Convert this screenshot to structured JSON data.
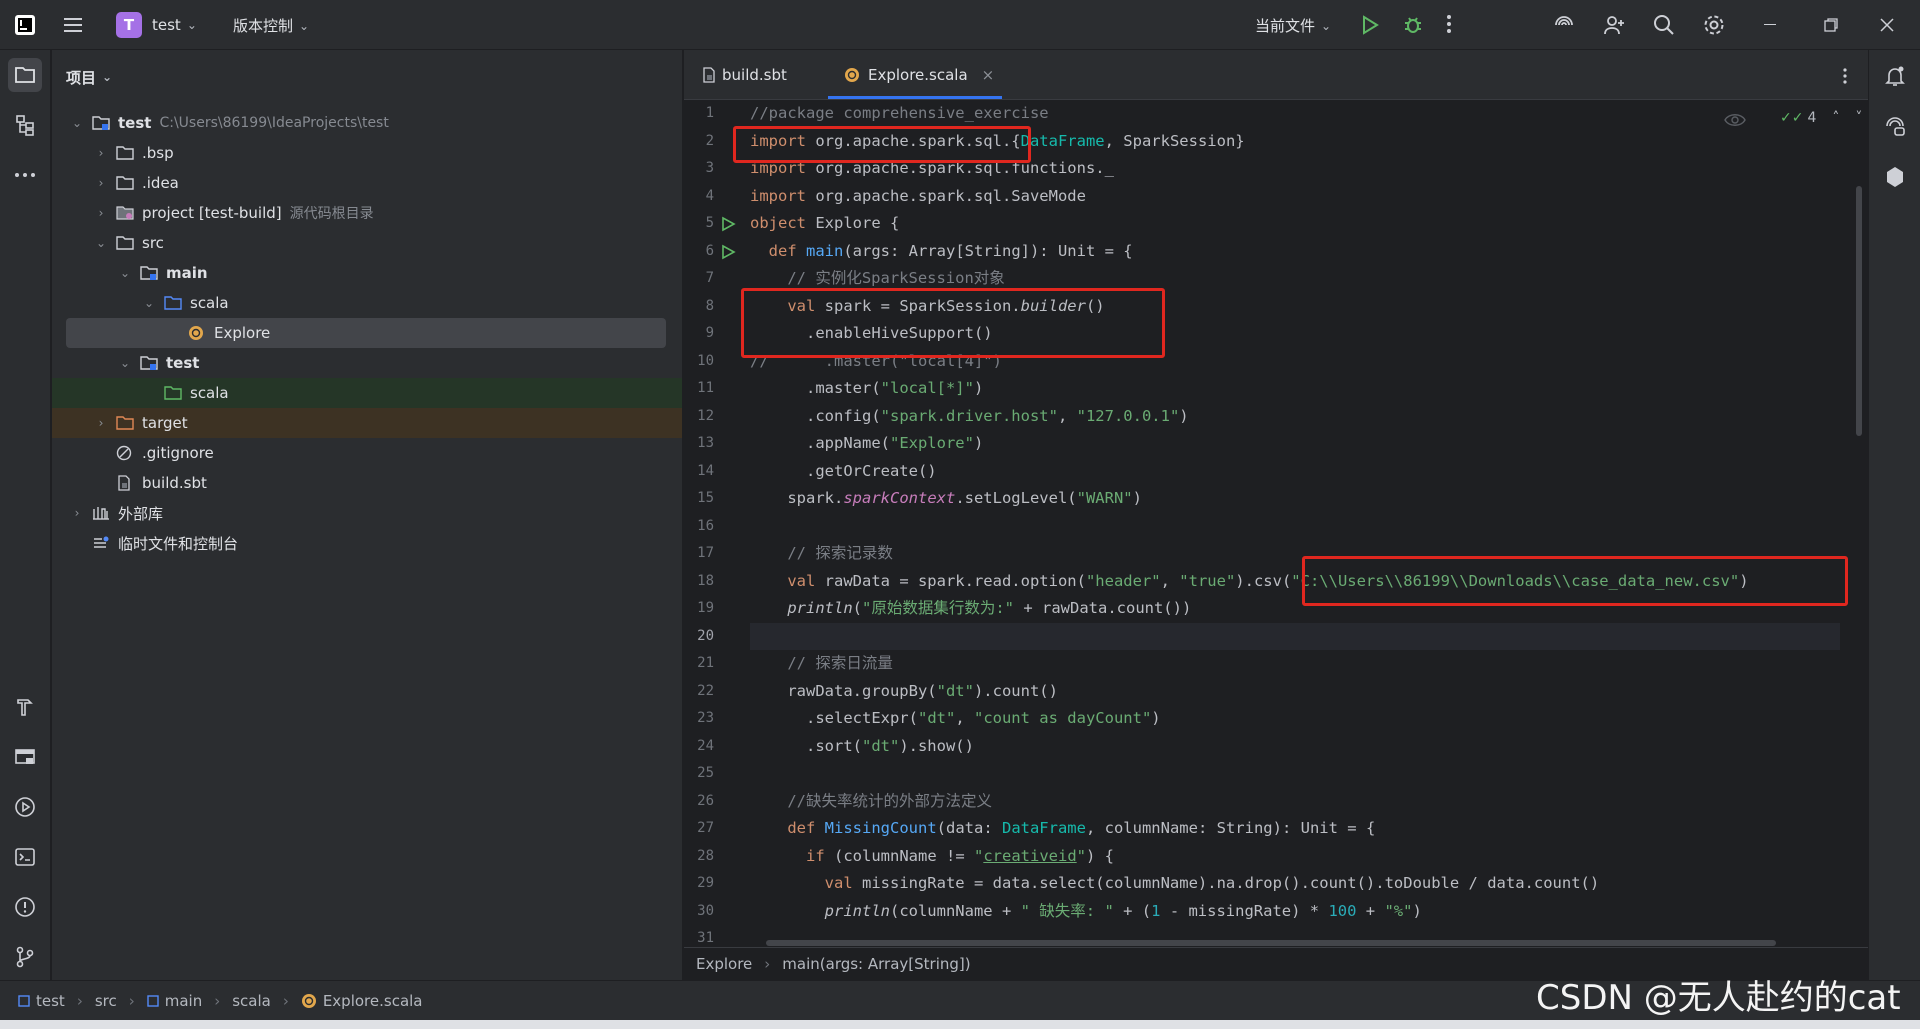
{
  "titlebar": {
    "project_letter": "T",
    "project_name": "test",
    "vcs_label": "版本控制",
    "run_config": "当前文件"
  },
  "project_panel": {
    "title": "项目",
    "tree": [
      {
        "label": "test",
        "sub": "C:\\Users\\86199\\IdeaProjects\\test"
      },
      {
        "label": ".bsp"
      },
      {
        "label": ".idea"
      },
      {
        "label": "project [test-build]",
        "sub": "源代码根目录"
      },
      {
        "label": "src"
      },
      {
        "label": "main"
      },
      {
        "label": "scala"
      },
      {
        "label": "Explore"
      },
      {
        "label": "test"
      },
      {
        "label": "scala"
      },
      {
        "label": "target"
      },
      {
        "label": ".gitignore"
      },
      {
        "label": "build.sbt"
      },
      {
        "label": "外部库"
      },
      {
        "label": "临时文件和控制台"
      }
    ]
  },
  "editor": {
    "tabs": [
      {
        "label": "build.sbt"
      },
      {
        "label": "Explore.scala"
      }
    ],
    "inspection_count": "4",
    "current_line": 20,
    "line_numbers": [
      "1",
      "2",
      "3",
      "4",
      "5",
      "6",
      "7",
      "8",
      "9",
      "10",
      "11",
      "12",
      "13",
      "14",
      "15",
      "16",
      "17",
      "18",
      "19",
      "20",
      "21",
      "22",
      "23",
      "24",
      "25",
      "26",
      "27",
      "28",
      "29",
      "30",
      "31"
    ],
    "breadcrumb": [
      "Explore",
      "main(args: Array[String])"
    ]
  },
  "statusbar": {
    "path": [
      "test",
      "src",
      "main",
      "scala",
      "Explore.scala"
    ]
  },
  "watermark": "CSDN @无人赴约的cat",
  "colors": {
    "accent": "#3574f0",
    "highlight_box": "#e0271f",
    "keyword": "#cf8e6d",
    "string": "#6aab73",
    "comment": "#7a7e85",
    "number": "#2aacb8"
  }
}
